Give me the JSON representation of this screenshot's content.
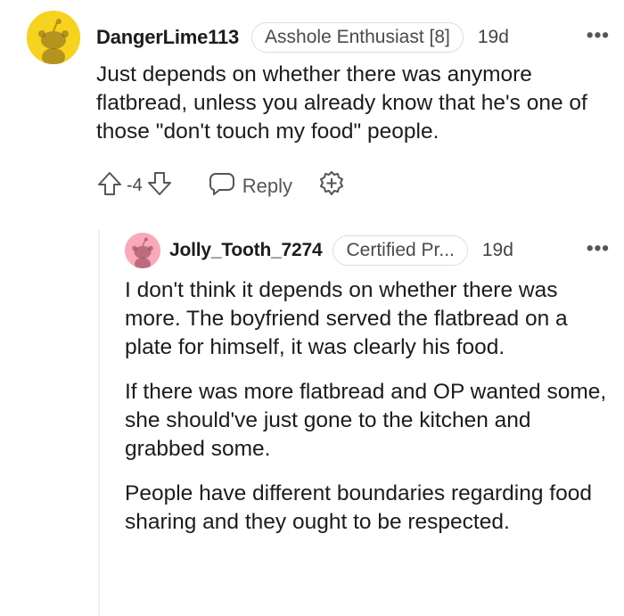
{
  "comments": [
    {
      "username": "DangerLime113",
      "flair": "Asshole Enthusiast [8]",
      "age": "19d",
      "more": "•••",
      "avatar_color": "#f5d31f",
      "text": "Just depends on whether there was anymore flatbread, unless you already know that he's one of those \"don't touch my food\" people.",
      "score": "-4",
      "reply_label": "Reply",
      "icons": [
        "upvote-icon",
        "downvote-icon",
        "comment-icon",
        "award-icon"
      ]
    },
    {
      "username": "Jolly_Tooth_7274",
      "flair": "Certified Pr...",
      "age": "19d",
      "more": "•••",
      "avatar_color": "#f9a9ba",
      "paragraphs": [
        "I don't think it depends on whether there was more. The boyfriend served the flatbread on a plate for himself, it was clearly his food.",
        "If there was more flatbread and OP wanted some, she should've just gone to the kitchen and grabbed some.",
        "People have different boundaries regarding food sharing and they ought to be respected."
      ]
    }
  ]
}
